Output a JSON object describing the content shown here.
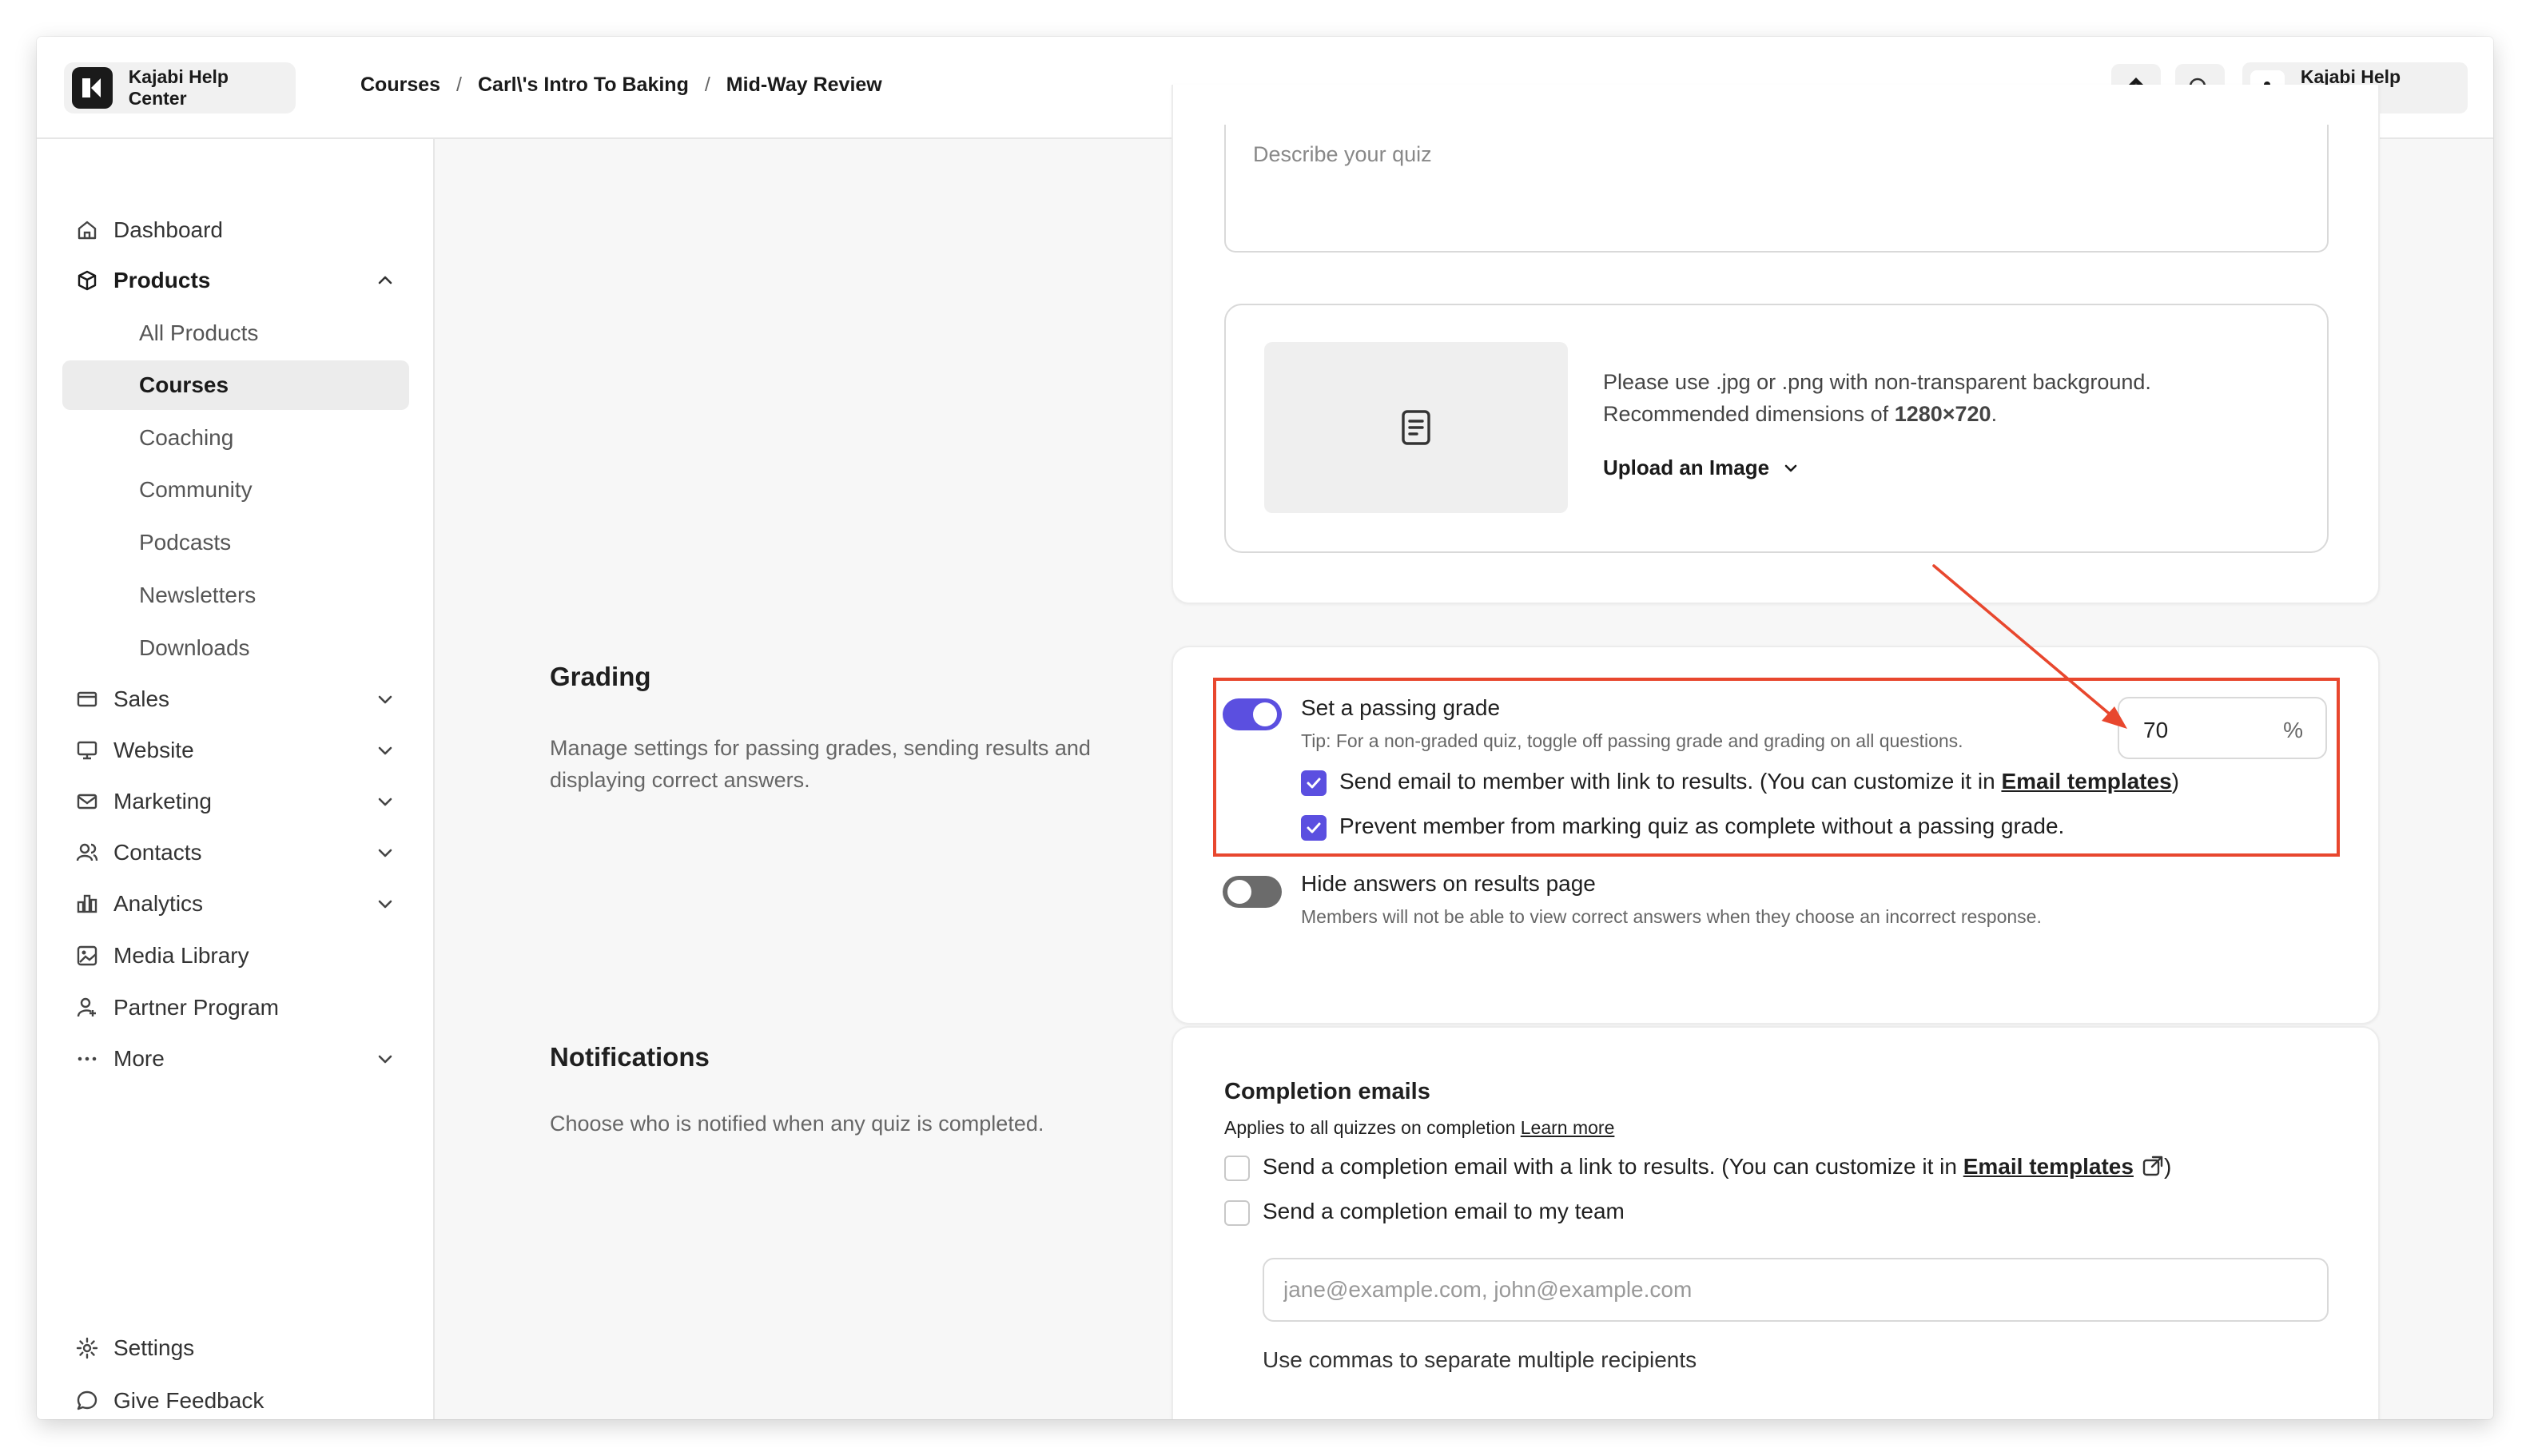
{
  "app": {
    "brand": "Kajabi Help Center",
    "account_name": "Kajabi Help Center"
  },
  "breadcrumb": [
    "Courses",
    "Carl\\'s Intro To Baking",
    "Mid-Way Review"
  ],
  "sidebar": {
    "items": [
      {
        "label": "Dashboard",
        "icon": "home-icon"
      },
      {
        "label": "Products",
        "icon": "box-icon",
        "expanded": true
      },
      {
        "label": "Sales",
        "icon": "card-icon"
      },
      {
        "label": "Website",
        "icon": "monitor-icon"
      },
      {
        "label": "Marketing",
        "icon": "mail-icon"
      },
      {
        "label": "Contacts",
        "icon": "users-icon"
      },
      {
        "label": "Analytics",
        "icon": "chart-icon"
      },
      {
        "label": "Media Library",
        "icon": "image-icon"
      },
      {
        "label": "Partner Program",
        "icon": "partner-icon"
      },
      {
        "label": "More",
        "icon": "more-icon"
      }
    ],
    "product_sub_items": [
      "All Products",
      "Courses",
      "Coaching",
      "Community",
      "Podcasts",
      "Newsletters",
      "Downloads"
    ],
    "active_sub_item": "Courses",
    "footer": [
      {
        "label": "Settings",
        "icon": "gear-icon"
      },
      {
        "label": "Give Feedback",
        "icon": "chat-icon"
      }
    ]
  },
  "quiz": {
    "description_placeholder": "Describe your quiz",
    "upload_hint_1": "Please use .jpg or .png with non-transparent background.",
    "upload_hint_2_prefix": "Recommended dimensions of ",
    "upload_hint_2_bold": "1280×720",
    "upload_hint_2_suffix": ".",
    "upload_label": "Upload an Image"
  },
  "grading": {
    "title": "Grading",
    "description": "Manage settings for passing grades, sending results and displaying correct answers.",
    "passing_grade_label": "Set a passing grade",
    "passing_grade_enabled": true,
    "passing_grade_tip": "Tip: For a non-graded quiz, toggle off passing grade and grading on all questions.",
    "passing_grade_value": "70",
    "passing_grade_unit": "%",
    "send_email_prefix": "Send email to member with link to results. (You can customize it in ",
    "send_email_link": "Email templates",
    "send_email_suffix": ")",
    "send_email_checked": true,
    "prevent_label": "Prevent member from marking quiz as complete without a passing grade.",
    "prevent_checked": true,
    "hide_answers_label": "Hide answers on results page",
    "hide_answers_enabled": false,
    "hide_answers_tip": "Members will not be able to view correct answers when they choose an incorrect response."
  },
  "notifications": {
    "title": "Notifications",
    "description": "Choose who is notified when any quiz is completed.",
    "card_title": "Completion emails",
    "card_subtitle_prefix": "Applies to all quizzes on completion ",
    "learn_more": "Learn more",
    "option1_prefix": "Send a completion email with a link to results. (You can customize it in ",
    "option1_link": "Email templates",
    "option1_suffix": ")",
    "option2": "Send a completion email to my team",
    "recipients_placeholder": "jane@example.com, john@example.com",
    "recipients_hint": "Use commas to separate multiple recipients"
  },
  "colors": {
    "accent": "#5b4fe0",
    "highlight": "#e8472e"
  }
}
